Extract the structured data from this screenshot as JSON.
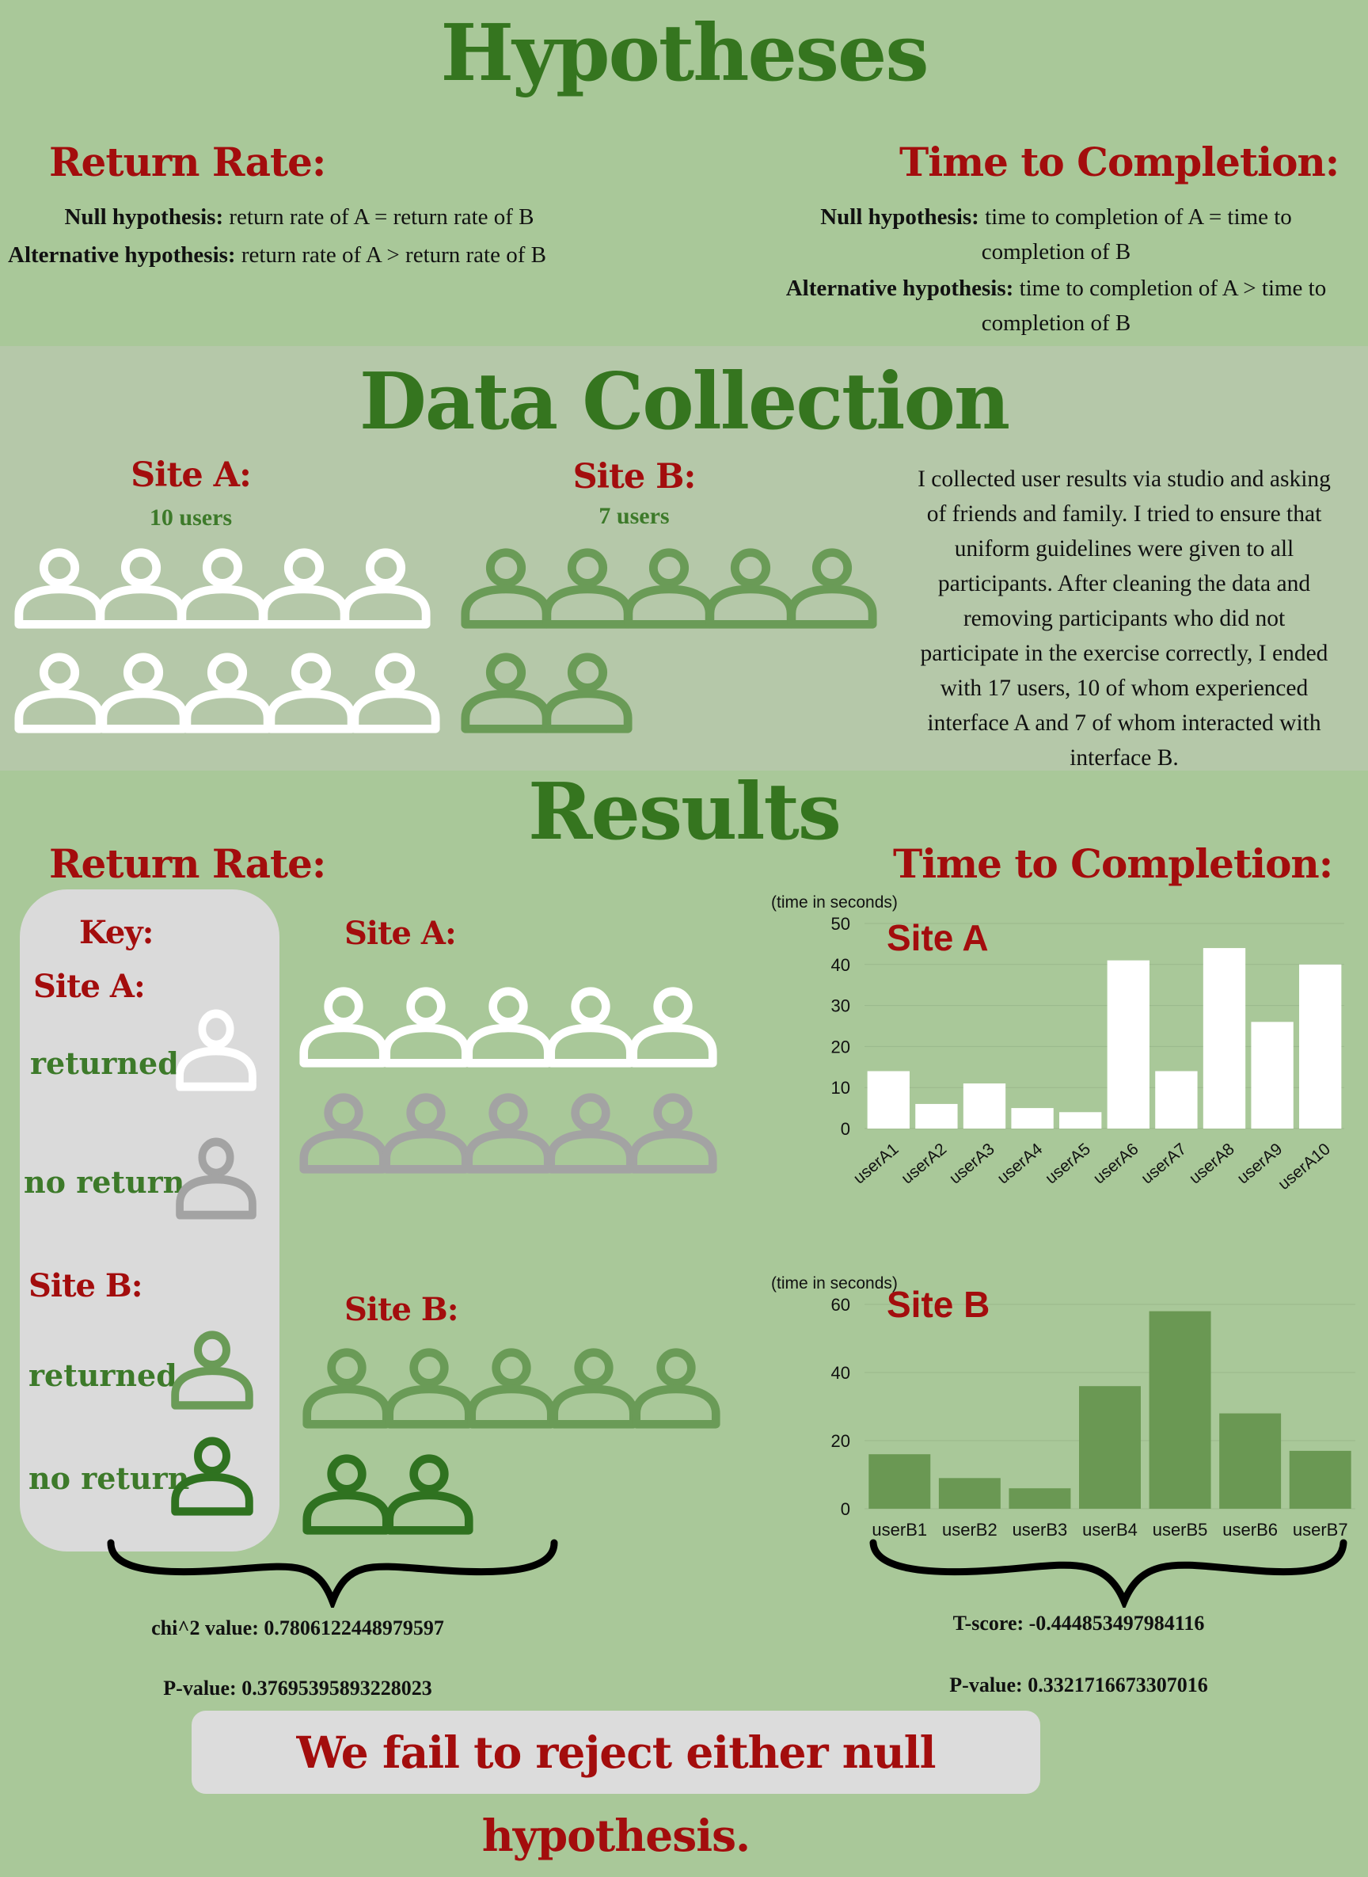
{
  "hypotheses": {
    "title": "Hypotheses",
    "return_rate": {
      "heading": "Return Rate:",
      "null_label": "Null hypothesis:",
      "null_text": " return rate of A = return rate of B",
      "alt_label": "Alternative hypothesis:",
      "alt_text": " return rate of A > return rate of B"
    },
    "time_to_completion": {
      "heading": "Time to Completion:",
      "null_label": "Null hypothesis:",
      "null_text_1": " time to completion of A = time to",
      "null_text_2": "completion of B",
      "alt_label": "Alternative hypothesis:",
      "alt_text_1": " time to completion of A > time to",
      "alt_text_2": "completion of B"
    }
  },
  "data_collection": {
    "title": "Data Collection",
    "site_a": {
      "label": "Site A:",
      "users": "10 users"
    },
    "site_b": {
      "label": "Site B:",
      "users": "7 users"
    },
    "paragraph": [
      "I collected user results via studio and asking",
      "of friends and family. I tried to ensure that",
      "uniform guidelines were given to all",
      "participants. After cleaning the data and",
      "removing participants who did not",
      "participate in the exercise correctly, I ended",
      "with 17 users, 10 of whom experienced",
      "interface A and 7 of whom interacted with",
      "interface B."
    ]
  },
  "results": {
    "title": "Results",
    "return_rate_heading": "Return Rate:",
    "ttc_heading": "Time to Completion:",
    "key": {
      "title": "Key:",
      "site_a": "Site A:",
      "site_b": "Site B:",
      "returned": "returned",
      "no_return": "no return"
    },
    "site_a_label": "Site A:",
    "site_b_label": "Site B:",
    "site_a_returned": 5,
    "site_a_no_return": 5,
    "site_b_returned": 5,
    "site_b_no_return": 2,
    "chi_line": "chi^2 value: 0.7806122448979597",
    "chi_p_line": "P-value: 0.37695395893228023",
    "t_line": "T-score: -0.444853497984116",
    "t_p_line": "P-value: 0.3321716673307016",
    "verdict": "We fail to reject either null hypothesis."
  },
  "colors": {
    "background": "#a9c899",
    "band": "#b5c8a9",
    "title_green": "#35751f",
    "heading_red": "#a30d0d",
    "site_a_icon": "#ffffff",
    "site_a_no_return_icon": "#a3a3a3",
    "site_b_returned_icon": "#6a9b57",
    "site_b_no_return_icon": "#2f7220",
    "bar_a": "#ffffff",
    "bar_b": "#6a9853"
  },
  "chart_data": [
    {
      "type": "bar",
      "title": "Site A",
      "ylabel": "(time in seconds)",
      "categories": [
        "userA1",
        "userA2",
        "userA3",
        "userA4",
        "userA5",
        "userA6",
        "userA7",
        "userA8",
        "userA9",
        "userA10"
      ],
      "values": [
        14,
        6,
        11,
        5,
        4,
        41,
        14,
        44,
        26,
        40
      ],
      "ylim": [
        0,
        50
      ],
      "yticks": [
        0,
        10,
        20,
        30,
        40,
        50
      ],
      "grid": true
    },
    {
      "type": "bar",
      "title": "Site B",
      "ylabel": "(time in seconds)",
      "categories": [
        "userB1",
        "userB2",
        "userB3",
        "userB4",
        "userB5",
        "userB6",
        "userB7"
      ],
      "values": [
        16,
        9,
        6,
        36,
        58,
        28,
        17
      ],
      "ylim": [
        0,
        60
      ],
      "yticks": [
        0,
        20,
        40,
        60
      ],
      "grid": true
    }
  ]
}
